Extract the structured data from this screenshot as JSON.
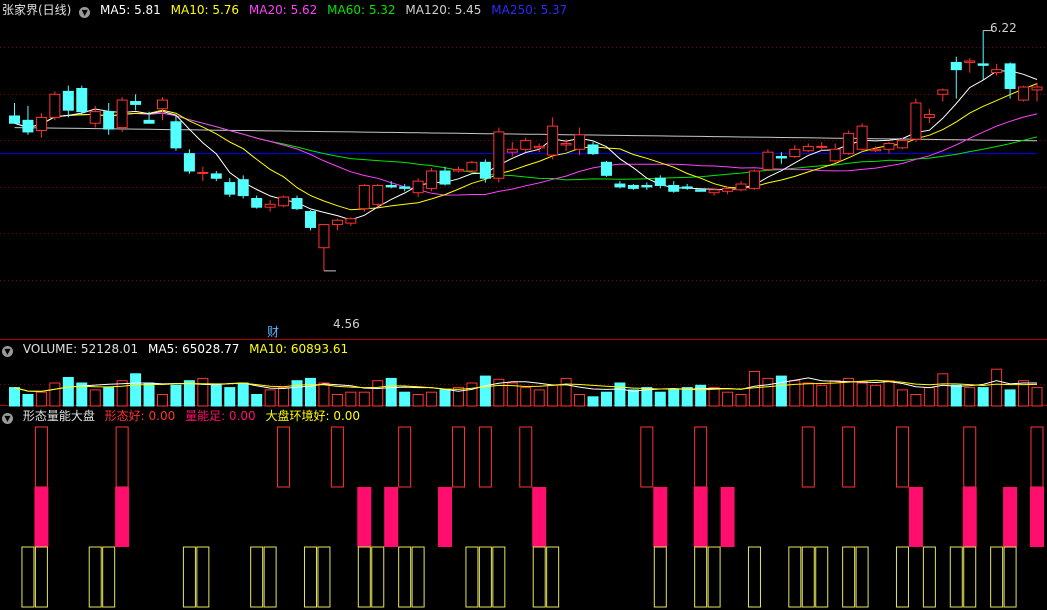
{
  "colors": {
    "bg": "#000000",
    "up": "#ff3232",
    "down": "#54ffff",
    "grid": "#7a0000",
    "ma5": "#ffffff",
    "ma10": "#ffff00",
    "ma20": "#ff40ff",
    "ma60": "#00e600",
    "ma120": "#c8c8c8",
    "ma250": "#0000ff",
    "pink": "#ff0e6e",
    "olive": "#e6e65a"
  },
  "header": {
    "title": "张家界(日线)",
    "ma5": "MA5: 5.81",
    "ma10": "MA10: 5.76",
    "ma20": "MA20: 5.62",
    "ma60": "MA60: 5.32",
    "ma120": "MA120: 5.45",
    "ma250": "MA250: 5.37"
  },
  "annotations": {
    "high": "6.22",
    "low": "4.56",
    "fin": "财"
  },
  "volume": {
    "label": "VOLUME: 52128.01",
    "ma5": "MA5: 65028.77",
    "ma10": "MA10: 60893.61"
  },
  "indicator": {
    "name": "形态量能大盘",
    "a": "形态好: 0.00",
    "b": "量能足: 0.00",
    "c": "大盘环境好: 0.00"
  },
  "chart_data": {
    "type": "candlestick",
    "price_range": [
      4.2,
      6.3
    ],
    "ohlc": [
      [
        5.63,
        5.72,
        5.6,
        5.58
      ],
      [
        5.6,
        5.7,
        5.5,
        5.52
      ],
      [
        5.53,
        5.65,
        5.48,
        5.62
      ],
      [
        5.62,
        5.8,
        5.6,
        5.78
      ],
      [
        5.8,
        5.84,
        5.62,
        5.67
      ],
      [
        5.82,
        5.84,
        5.64,
        5.66
      ],
      [
        5.58,
        5.7,
        5.55,
        5.66
      ],
      [
        5.66,
        5.72,
        5.5,
        5.54
      ],
      [
        5.55,
        5.76,
        5.52,
        5.74
      ],
      [
        5.73,
        5.78,
        5.67,
        5.71
      ],
      [
        5.6,
        5.66,
        5.58,
        5.58
      ],
      [
        5.68,
        5.76,
        5.6,
        5.74
      ],
      [
        5.59,
        5.63,
        5.39,
        5.41
      ],
      [
        5.37,
        5.4,
        5.23,
        5.25
      ],
      [
        5.24,
        5.28,
        5.18,
        5.24
      ],
      [
        5.23,
        5.25,
        5.18,
        5.2
      ],
      [
        5.17,
        5.2,
        5.07,
        5.09
      ],
      [
        5.19,
        5.22,
        5.06,
        5.08
      ],
      [
        5.06,
        5.08,
        4.99,
        5.0
      ],
      [
        5.0,
        5.05,
        4.97,
        5.02
      ],
      [
        5.01,
        5.08,
        5.0,
        5.07
      ],
      [
        5.06,
        5.08,
        4.98,
        4.99
      ],
      [
        4.97,
        4.98,
        4.84,
        4.86
      ],
      [
        4.72,
        4.87,
        4.56,
        4.88
      ],
      [
        4.88,
        4.92,
        4.84,
        4.91
      ],
      [
        4.89,
        4.93,
        4.87,
        4.92
      ],
      [
        4.99,
        5.16,
        4.97,
        5.15
      ],
      [
        5.02,
        5.16,
        5.0,
        5.15
      ],
      [
        5.15,
        5.18,
        5.13,
        5.14
      ],
      [
        5.14,
        5.16,
        5.11,
        5.13
      ],
      [
        5.1,
        5.2,
        5.07,
        5.18
      ],
      [
        5.13,
        5.27,
        5.11,
        5.25
      ],
      [
        5.25,
        5.28,
        5.15,
        5.16
      ],
      [
        5.25,
        5.28,
        5.24,
        5.26
      ],
      [
        5.25,
        5.32,
        5.24,
        5.31
      ],
      [
        5.31,
        5.33,
        5.17,
        5.2
      ],
      [
        5.2,
        5.55,
        5.17,
        5.52
      ],
      [
        5.38,
        5.45,
        5.35,
        5.4
      ],
      [
        5.4,
        5.48,
        5.38,
        5.46
      ],
      [
        5.41,
        5.44,
        5.38,
        5.42
      ],
      [
        5.36,
        5.62,
        5.33,
        5.56
      ],
      [
        5.43,
        5.47,
        5.39,
        5.44
      ],
      [
        5.4,
        5.55,
        5.36,
        5.5
      ],
      [
        5.43,
        5.45,
        5.36,
        5.37
      ],
      [
        5.31,
        5.32,
        5.21,
        5.22
      ],
      [
        5.16,
        5.18,
        5.13,
        5.14
      ],
      [
        5.15,
        5.16,
        5.12,
        5.13
      ],
      [
        5.15,
        5.17,
        5.12,
        5.14
      ],
      [
        5.2,
        5.22,
        5.13,
        5.15
      ],
      [
        5.15,
        5.18,
        5.1,
        5.11
      ],
      [
        5.14,
        5.16,
        5.12,
        5.13
      ],
      [
        5.12,
        5.13,
        5.11,
        5.11
      ],
      [
        5.1,
        5.13,
        5.08,
        5.12
      ],
      [
        5.11,
        5.14,
        5.09,
        5.13
      ],
      [
        5.12,
        5.18,
        5.11,
        5.16
      ],
      [
        5.13,
        5.26,
        5.12,
        5.25
      ],
      [
        5.26,
        5.4,
        5.25,
        5.38
      ],
      [
        5.35,
        5.38,
        5.3,
        5.34
      ],
      [
        5.35,
        5.43,
        5.34,
        5.4
      ],
      [
        5.39,
        5.44,
        5.38,
        5.42
      ],
      [
        5.42,
        5.45,
        5.39,
        5.42
      ],
      [
        5.32,
        5.44,
        5.31,
        5.4
      ],
      [
        5.37,
        5.53,
        5.36,
        5.51
      ],
      [
        5.4,
        5.58,
        5.38,
        5.56
      ],
      [
        5.39,
        5.42,
        5.38,
        5.4
      ],
      [
        5.4,
        5.45,
        5.37,
        5.44
      ],
      [
        5.41,
        5.48,
        5.4,
        5.46
      ],
      [
        5.47,
        5.75,
        5.45,
        5.72
      ],
      [
        5.62,
        5.68,
        5.58,
        5.64
      ],
      [
        5.78,
        5.82,
        5.73,
        5.81
      ],
      [
        6.0,
        6.04,
        5.75,
        5.95
      ],
      [
        6.0,
        6.03,
        5.93,
        6.01
      ],
      [
        5.99,
        6.22,
        5.88,
        5.98
      ],
      [
        5.93,
        5.99,
        5.91,
        5.95
      ],
      [
        5.99,
        6.0,
        5.75,
        5.82
      ],
      [
        5.74,
        5.84,
        5.73,
        5.83
      ],
      [
        5.81,
        5.86,
        5.73,
        5.83
      ]
    ],
    "volume": [
      0.4,
      0.25,
      0.3,
      0.5,
      0.62,
      0.5,
      0.35,
      0.4,
      0.55,
      0.7,
      0.5,
      0.25,
      0.45,
      0.55,
      0.6,
      0.45,
      0.4,
      0.5,
      0.25,
      0.35,
      0.4,
      0.55,
      0.6,
      0.5,
      0.25,
      0.3,
      0.3,
      0.55,
      0.6,
      0.3,
      0.25,
      0.3,
      0.35,
      0.4,
      0.5,
      0.65,
      0.58,
      0.5,
      0.4,
      0.35,
      0.45,
      0.6,
      0.25,
      0.2,
      0.3,
      0.5,
      0.35,
      0.4,
      0.3,
      0.35,
      0.4,
      0.45,
      0.4,
      0.3,
      0.25,
      0.75,
      0.6,
      0.65,
      0.55,
      0.5,
      0.45,
      0.55,
      0.6,
      0.5,
      0.45,
      0.55,
      0.35,
      0.25,
      0.4,
      0.7,
      0.45,
      0.4,
      0.4,
      0.8,
      0.35,
      0.55,
      0.4
    ]
  }
}
